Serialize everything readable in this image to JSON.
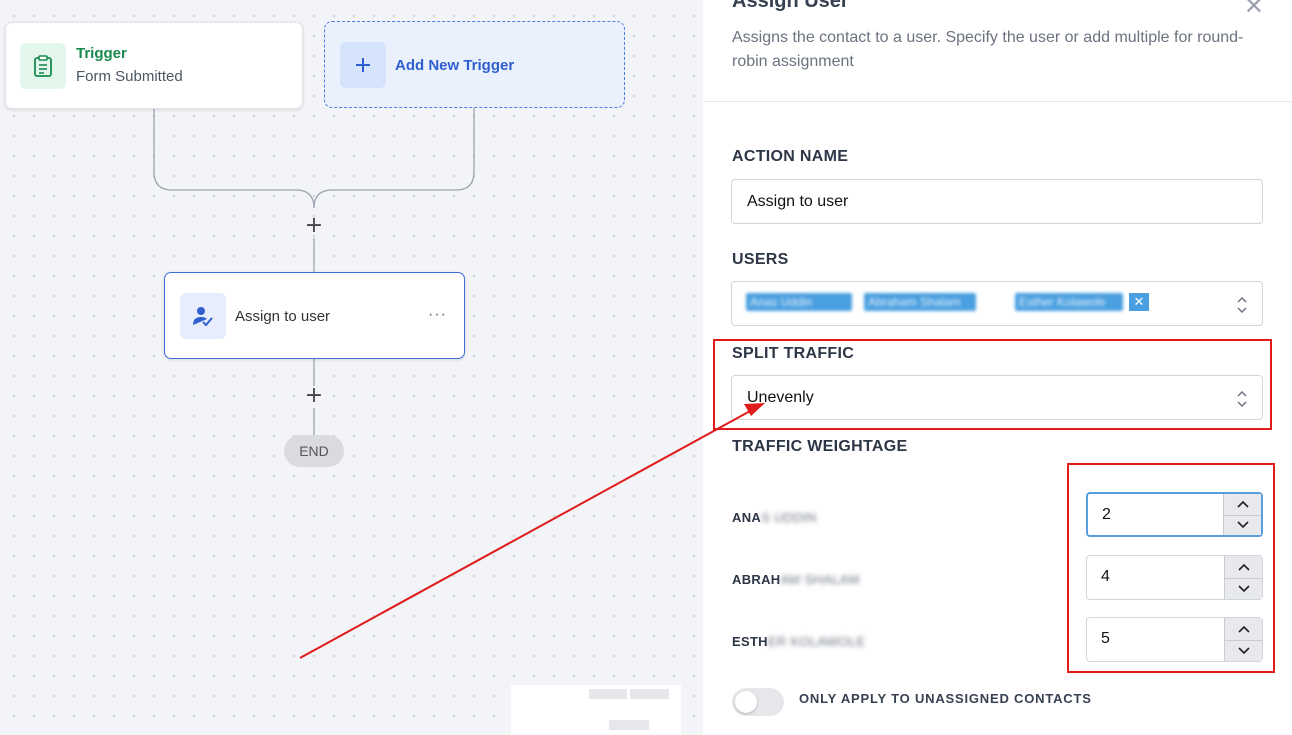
{
  "canvas": {
    "trigger": {
      "title": "Trigger",
      "subtitle": "Form Submitted",
      "icon": "clipboard-icon"
    },
    "add_trigger": {
      "label": "Add New Trigger",
      "icon": "plus-icon"
    },
    "add_step_symbol": "+",
    "action": {
      "label": "Assign to user",
      "icon": "user-check-icon",
      "menu": "···"
    },
    "end_label": "END"
  },
  "panel": {
    "title": "Assign User",
    "description": "Assigns the contact to a user. Specify the user or add multiple for round-robin assignment",
    "action_name": {
      "label": "ACTION NAME",
      "value": "Assign to user"
    },
    "users": {
      "label": "USERS",
      "chips": [
        "Anas Uddin",
        "Abraham Shalam",
        "Esther Kolawole"
      ]
    },
    "split_traffic": {
      "label": "SPLIT TRAFFIC",
      "value": "Unevenly"
    },
    "traffic_weightage": {
      "label": "TRAFFIC WEIGHTAGE",
      "rows": [
        {
          "name_visible": "ANA",
          "name_hidden": "S UDDIN",
          "value": "2"
        },
        {
          "name_visible": "ABRAH",
          "name_hidden": "AM SHALAM",
          "value": "4"
        },
        {
          "name_visible": "ESTH",
          "name_hidden": "ER KOLAWOLE",
          "value": "5"
        }
      ]
    },
    "toggle": {
      "label": "ONLY APPLY TO UNASSIGNED CONTACTS",
      "on": false
    }
  },
  "colors": {
    "accent": "#3e6ed8",
    "trigger_green": "#1a8a4f",
    "annotation_red": "#e01b1b",
    "chip_blue": "#4a9fe0"
  }
}
